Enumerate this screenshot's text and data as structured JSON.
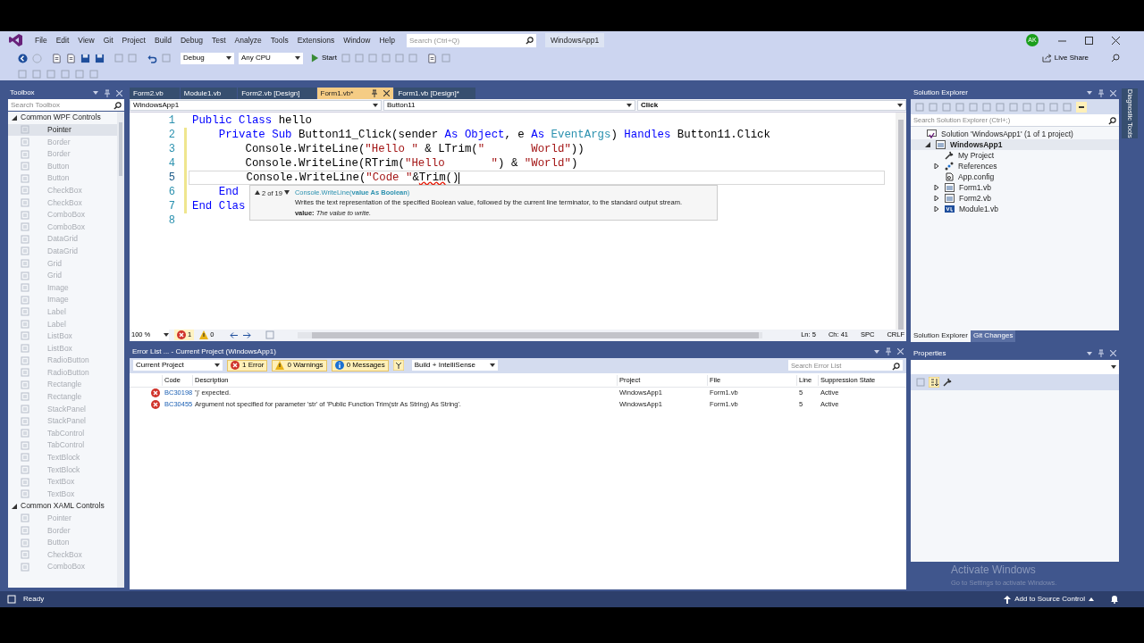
{
  "menu": [
    "File",
    "Edit",
    "View",
    "Git",
    "Project",
    "Build",
    "Debug",
    "Test",
    "Analyze",
    "Tools",
    "Extensions",
    "Window",
    "Help"
  ],
  "search": {
    "placeholder": "Search (Ctrl+Q)"
  },
  "solution_name": "WindowsApp1",
  "account_initials": "AK",
  "live_share": "Live Share",
  "toolbar": {
    "configuration": "Debug",
    "platform": "Any CPU",
    "start": "Start"
  },
  "toolbox": {
    "title": "Toolbox",
    "search": {
      "placeholder": "Search Toolbox"
    },
    "groups": [
      {
        "name": "Common WPF Controls",
        "expanded": true,
        "items": [
          {
            "label": "Pointer",
            "selected": true,
            "disabled": false
          },
          {
            "label": "Border",
            "selected": false,
            "disabled": true
          },
          {
            "label": "Border",
            "selected": false,
            "disabled": true
          },
          {
            "label": "Button",
            "selected": false,
            "disabled": true
          },
          {
            "label": "Button",
            "selected": false,
            "disabled": true
          },
          {
            "label": "CheckBox",
            "selected": false,
            "disabled": true
          },
          {
            "label": "CheckBox",
            "selected": false,
            "disabled": true
          },
          {
            "label": "ComboBox",
            "selected": false,
            "disabled": true
          },
          {
            "label": "ComboBox",
            "selected": false,
            "disabled": true
          },
          {
            "label": "DataGrid",
            "selected": false,
            "disabled": true
          },
          {
            "label": "DataGrid",
            "selected": false,
            "disabled": true
          },
          {
            "label": "Grid",
            "selected": false,
            "disabled": true
          },
          {
            "label": "Grid",
            "selected": false,
            "disabled": true
          },
          {
            "label": "Image",
            "selected": false,
            "disabled": true
          },
          {
            "label": "Image",
            "selected": false,
            "disabled": true
          },
          {
            "label": "Label",
            "selected": false,
            "disabled": true
          },
          {
            "label": "Label",
            "selected": false,
            "disabled": true
          },
          {
            "label": "ListBox",
            "selected": false,
            "disabled": true
          },
          {
            "label": "ListBox",
            "selected": false,
            "disabled": true
          },
          {
            "label": "RadioButton",
            "selected": false,
            "disabled": true
          },
          {
            "label": "RadioButton",
            "selected": false,
            "disabled": true
          },
          {
            "label": "Rectangle",
            "selected": false,
            "disabled": true
          },
          {
            "label": "Rectangle",
            "selected": false,
            "disabled": true
          },
          {
            "label": "StackPanel",
            "selected": false,
            "disabled": true
          },
          {
            "label": "StackPanel",
            "selected": false,
            "disabled": true
          },
          {
            "label": "TabControl",
            "selected": false,
            "disabled": true
          },
          {
            "label": "TabControl",
            "selected": false,
            "disabled": true
          },
          {
            "label": "TextBlock",
            "selected": false,
            "disabled": true
          },
          {
            "label": "TextBlock",
            "selected": false,
            "disabled": true
          },
          {
            "label": "TextBox",
            "selected": false,
            "disabled": true
          },
          {
            "label": "TextBox",
            "selected": false,
            "disabled": true
          }
        ]
      },
      {
        "name": "Common XAML Controls",
        "expanded": true,
        "items": [
          {
            "label": "Pointer",
            "selected": false,
            "disabled": true
          },
          {
            "label": "Border",
            "selected": false,
            "disabled": true
          },
          {
            "label": "Button",
            "selected": false,
            "disabled": true
          },
          {
            "label": "CheckBox",
            "selected": false,
            "disabled": true
          },
          {
            "label": "ComboBox",
            "selected": false,
            "disabled": true
          }
        ]
      }
    ]
  },
  "editor": {
    "tabs": [
      {
        "label": "Form2.vb",
        "selected": false
      },
      {
        "label": "Module1.vb",
        "selected": false
      },
      {
        "label": "Form2.vb [Design]",
        "selected": false
      },
      {
        "label": "Form1.vb*",
        "selected": true
      },
      {
        "label": "Form1.vb [Design]*",
        "selected": false
      }
    ],
    "nav": [
      "WindowsApp1",
      "Button11",
      "Click"
    ],
    "lines": [
      {
        "number": "1",
        "current": false,
        "tokens": [
          {
            "kind": "keyword",
            "text": "Public Class"
          },
          {
            "kind": "plain",
            "text": " hello"
          }
        ]
      },
      {
        "number": "2",
        "current": false,
        "tokens": [
          {
            "kind": "keyword",
            "text": "    Private Sub"
          },
          {
            "kind": "plain",
            "text": " Button11_Click(sender "
          },
          {
            "kind": "keyword",
            "text": "As Object"
          },
          {
            "kind": "plain",
            "text": ", e "
          },
          {
            "kind": "keyword",
            "text": "As "
          },
          {
            "kind": "type",
            "text": "EventArgs"
          },
          {
            "kind": "plain",
            "text": ") "
          },
          {
            "kind": "keyword",
            "text": "Handles"
          },
          {
            "kind": "plain",
            "text": " Button11.Click"
          }
        ]
      },
      {
        "number": "3",
        "current": false,
        "tokens": [
          {
            "kind": "plain",
            "text": "        Console.WriteLine("
          },
          {
            "kind": "string",
            "text": "\"Hello \""
          },
          {
            "kind": "plain",
            "text": " & LTrim("
          },
          {
            "kind": "string",
            "text": "\"       World\""
          },
          {
            "kind": "plain",
            "text": "))"
          }
        ]
      },
      {
        "number": "4",
        "current": false,
        "tokens": [
          {
            "kind": "plain",
            "text": "        Console.WriteLine(RTrim("
          },
          {
            "kind": "string",
            "text": "\"Hello       \""
          },
          {
            "kind": "plain",
            "text": ") & "
          },
          {
            "kind": "string",
            "text": "\"World\""
          },
          {
            "kind": "plain",
            "text": ")"
          }
        ]
      },
      {
        "number": "5",
        "current": true,
        "tokens": [
          {
            "kind": "plain",
            "text": "        Console.WriteLine("
          },
          {
            "kind": "string",
            "text": "\"Code \""
          },
          {
            "kind": "plain",
            "text": "&"
          },
          {
            "kind": "error",
            "text": "Trim"
          },
          {
            "kind": "plain",
            "text": "()"
          }
        ]
      },
      {
        "number": "6",
        "current": false,
        "tokens": [
          {
            "kind": "keyword",
            "text": "    End"
          }
        ]
      },
      {
        "number": "7",
        "current": false,
        "tokens": [
          {
            "kind": "keyword",
            "text": "End Clas"
          }
        ]
      },
      {
        "number": "8",
        "current": false
      }
    ],
    "tooltip": {
      "counter": "2 of 19",
      "signature": "Console.WriteLine(**value As Boolean**)",
      "description": "Writes the text representation of the specified Boolean value, followed by the current line terminator, to the standard output stream.",
      "parameter": "**value:** *The value to write.*"
    },
    "status": {
      "zoom": "100 %",
      "errors": "1",
      "warnings": "0",
      "line": "Ln: 5",
      "column": "Ch: 41",
      "indent": "SPC",
      "line_ending": "CRLF"
    }
  },
  "error_list": {
    "title": "Error List ... - Current Project (WindowsApp1)",
    "scope": "Current Project",
    "filters": [
      {
        "kind": "error",
        "label": "1 Error",
        "selected": true
      },
      {
        "kind": "warning",
        "label": "0 Warnings",
        "selected": true
      },
      {
        "kind": "message",
        "label": "0 Messages",
        "selected": true
      }
    ],
    "source": "Build + IntelliSense",
    "search": {
      "placeholder": "Search Error List"
    },
    "columns": [
      "Code",
      "Description",
      "Project",
      "File",
      "Line",
      "Suppression State"
    ],
    "rows": [
      {
        "code": "BC30198",
        "description": "')' expected.",
        "project": "WindowsApp1",
        "file": "Form1.vb",
        "line": "5",
        "state": "Active"
      },
      {
        "code": "BC30455",
        "description": "Argument not specified for parameter 'str' of 'Public Function Trim(str As String) As String'.",
        "project": "WindowsApp1",
        "file": "Form1.vb",
        "line": "5",
        "state": "Active"
      }
    ]
  },
  "solution_explorer": {
    "title": "Solution Explorer",
    "search": {
      "placeholder": "Search Solution Explorer (Ctrl+;)"
    },
    "tree": [
      {
        "label": "Solution 'WindowsApp1' (1 of 1 project)",
        "kind": "solution",
        "bold": false,
        "selected": false,
        "children": [
          {
            "label": "WindowsApp1",
            "kind": "project",
            "bold": true,
            "selected": true,
            "expanded": true,
            "children": [
              {
                "label": "My Project",
                "kind": "wrench",
                "bold": false,
                "selected": false
              },
              {
                "label": "References",
                "kind": "references",
                "bold": false,
                "selected": false,
                "expanded": false
              },
              {
                "label": "App.config",
                "kind": "config",
                "bold": false,
                "selected": false
              },
              {
                "label": "Form1.vb",
                "kind": "form",
                "bold": false,
                "selected": false,
                "expanded": false
              },
              {
                "label": "Form2.vb",
                "kind": "form",
                "bold": false,
                "selected": false,
                "expanded": false
              },
              {
                "label": "Module1.vb",
                "kind": "module",
                "bold": false,
                "selected": false,
                "expanded": false
              }
            ]
          }
        ]
      }
    ],
    "tabs": [
      {
        "label": "Solution Explorer",
        "selected": true
      },
      {
        "label": "Git Changes",
        "selected": false
      }
    ]
  },
  "properties": {
    "title": "Properties"
  },
  "side_tab": "Diagnostic Tools",
  "activation": {
    "title": "Activate Windows",
    "hint": "Go to Settings to activate Windows."
  },
  "status_bar": {
    "text": "Ready",
    "source_control": "Add to Source Control"
  }
}
